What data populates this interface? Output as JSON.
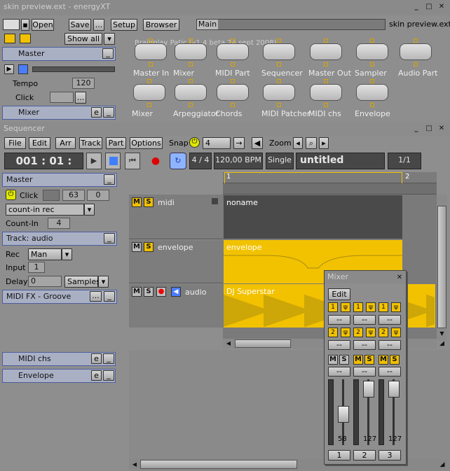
{
  "window": {
    "title": "skin preview.ext - energyXT",
    "filename": "skin preview.ext"
  },
  "toolbar": {
    "open": "Open",
    "save": "Save",
    "more": "...",
    "setup": "Setup",
    "browser": "Browser",
    "tab_main": "Main"
  },
  "left": {
    "show_all": "Show all",
    "master": "Master",
    "tempo_label": "Tempo",
    "tempo": "120",
    "click_label": "Click",
    "click_btn": "...",
    "mixer": "Mixer",
    "e": "e",
    "min": "_"
  },
  "modules": [
    {
      "label": "Master In"
    },
    {
      "label": "Mixer"
    },
    {
      "label": "MIDI Part"
    },
    {
      "label": "Sequencer"
    },
    {
      "label": "Master Out"
    },
    {
      "label": "Sampler"
    },
    {
      "label": "Audio Part"
    },
    {
      "label": "Mixer"
    },
    {
      "label": "Arpeggiator"
    },
    {
      "label": "Chords"
    },
    {
      "label": "MIDI Patcher"
    },
    {
      "label": "MIDI chs"
    },
    {
      "label": "Envelope"
    }
  ],
  "main_caption": "Brainplay Patic (v1.4 beta 24 sept 2008)",
  "sequencer": {
    "title": "Sequencer",
    "menu": [
      "File",
      "Edit",
      "Arr",
      "Track",
      "Part",
      "Options"
    ],
    "snap_label": "Snap",
    "snap": "4",
    "zoom_label": "Zoom",
    "position": "001 : 01 : 000",
    "signature": "4 / 4",
    "bpm": "120,00 BPM",
    "mode": "Single",
    "song": "untitled",
    "page": "1/1",
    "ruler": [
      "1",
      "2"
    ]
  },
  "seq_left": {
    "master": "Master",
    "click": "Click",
    "click_val": "63",
    "click_val2": "0",
    "countin_mode": "count-in rec",
    "countin_label": "Count-In",
    "countin": "4",
    "track": "Track: audio",
    "rec_label": "Rec",
    "rec": "Man",
    "input_label": "Input",
    "input": "1",
    "delay_label": "Delay",
    "delay": "0",
    "samples": "Samples",
    "midifx": "MIDI FX - Groove",
    "dots": "...",
    "min": "_"
  },
  "tracks": [
    {
      "name": "midi",
      "part": "noname"
    },
    {
      "name": "envelope",
      "part": "envelope"
    },
    {
      "name": "audio",
      "part": "DJ Superstar"
    }
  ],
  "ms": {
    "m": "M",
    "s": "S"
  },
  "bottom_left": {
    "midichs": "MIDI chs",
    "envelope": "Envelope",
    "e": "e",
    "min": "_"
  },
  "mixer": {
    "title": "Mixer",
    "edit": "Edit",
    "dash": "--",
    "fader": [
      "58",
      "127",
      "127"
    ],
    "channels": [
      "1",
      "2",
      "3"
    ],
    "one": "1",
    "two": "2"
  }
}
